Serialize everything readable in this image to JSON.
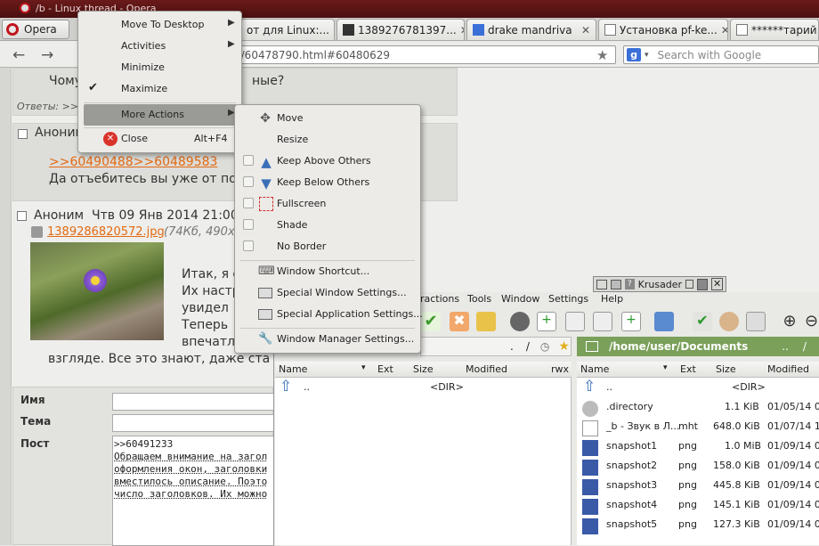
{
  "window": {
    "title": "/b - Linux thread - Opera"
  },
  "browser": {
    "menu_label": "Opera",
    "tabs": [
      {
        "label": "от для Linux:...",
        "close": "✕"
      },
      {
        "label": "1389276781397...",
        "close": "✕"
      },
      {
        "label": "drake mandriva",
        "close": "✕"
      },
      {
        "label": "Установка pf-ke...",
        "close": "✕"
      },
      {
        "label": "******тарий 1",
        "close": ""
      }
    ],
    "url": "es/60478790.html#60480629",
    "search_placeholder": "Search with Google",
    "search_engine_glyph": "g"
  },
  "page": {
    "post1": {
      "text": "Чому",
      "text_right": "ные?",
      "replies_label": "Ответы: >>6"
    },
    "post2": {
      "author": "Аноним",
      "quote_link": ">>60490488>>60489583",
      "text": "Да отъебитесь вы уже от по"
    },
    "post3": {
      "author": "Аноним",
      "date": "Чтв 09 Янв 2014 21:00",
      "file_link": "1389286820572.jpg",
      "file_meta": "(74Кб, 490x3",
      "lines": [
        "Итак, я с",
        "Их настр",
        "увидел",
        "Теперь",
        "впечатл"
      ],
      "last_line": "взгляде. Все это знают, даже ста"
    },
    "form": {
      "name_label": "Имя",
      "subject_label": "Тема",
      "post_label": "Пост",
      "post_lines": [
        ">>60491233",
        "Обращаем внимание на загол",
        "оформления окон, заголовки",
        "вместилось описание. Поэто",
        "число заголовков. Их можно"
      ]
    }
  },
  "window_menu": {
    "items": [
      {
        "label": "Move To Desktop",
        "submenu": true
      },
      {
        "label": "Activities",
        "submenu": true
      },
      {
        "label": "Minimize"
      },
      {
        "label": "Maximize",
        "checked": true
      },
      {
        "label": "More Actions",
        "submenu": true,
        "highlighted": true
      },
      {
        "label": "Close",
        "shortcut": "Alt+F4",
        "icon": "close-icon"
      }
    ]
  },
  "more_actions_menu": {
    "items": [
      {
        "label": "Move",
        "icon": "move-icon"
      },
      {
        "label": "Resize"
      },
      {
        "label": "Keep Above Others",
        "icon": "arrow-up-icon",
        "checkbox": true
      },
      {
        "label": "Keep Below Others",
        "icon": "arrow-down-icon",
        "checkbox": true
      },
      {
        "label": "Fullscreen",
        "icon": "fullscreen-icon",
        "checkbox": true
      },
      {
        "label": "Shade",
        "checkbox": true
      },
      {
        "label": "No Border",
        "checkbox": true
      },
      {
        "label": "Window Shortcut...",
        "icon": "keyboard-icon"
      },
      {
        "label": "Special Window Settings...",
        "icon": "window-settings-icon"
      },
      {
        "label": "Special Application Settings...",
        "icon": "app-settings-icon"
      },
      {
        "label": "Window Manager Settings...",
        "icon": "wrench-icon"
      }
    ]
  },
  "krusader": {
    "title": "Krusader",
    "title_glyph": "?",
    "menus": [
      "ractions",
      "Tools",
      "Window",
      "Settings",
      "Help"
    ],
    "left_path": ".",
    "left_path_sep": "/",
    "right_path": "/home/user/Documents",
    "right_path_tail": "..",
    "right_path_sep": "/",
    "columns": [
      "Name",
      "Ext",
      "Size",
      "Modified",
      "rwx"
    ],
    "right_columns": [
      "Name",
      "Ext",
      "Size",
      "Modified"
    ],
    "left_files": [
      {
        "name": "..",
        "ext": "",
        "size": "<DIR>",
        "modified": ""
      }
    ],
    "right_files": [
      {
        "name": "..",
        "ext": "",
        "size": "<DIR>",
        "modified": ""
      },
      {
        "name": ".directory",
        "ext": "",
        "size": "1.1 KiB",
        "modified": "01/05/14 04"
      },
      {
        "name": "_b - Звук в Л...",
        "ext": "mht",
        "size": "648.0 KiB",
        "modified": "01/07/14 12"
      },
      {
        "name": "snapshot1",
        "ext": "png",
        "size": "1.0 MiB",
        "modified": "01/09/14 04"
      },
      {
        "name": "snapshot2",
        "ext": "png",
        "size": "158.0 KiB",
        "modified": "01/09/14 04"
      },
      {
        "name": "snapshot3",
        "ext": "png",
        "size": "445.8 KiB",
        "modified": "01/09/14 04"
      },
      {
        "name": "snapshot4",
        "ext": "png",
        "size": "145.1 KiB",
        "modified": "01/09/14 04"
      },
      {
        "name": "snapshot5",
        "ext": "png",
        "size": "127.3 KiB",
        "modified": "01/09/14 08"
      }
    ]
  },
  "colors": {
    "link": "#e36a13",
    "path_bar": "#7aa05a",
    "menu_highlight": "#9a9a97",
    "title_bar": "#5a1414"
  }
}
